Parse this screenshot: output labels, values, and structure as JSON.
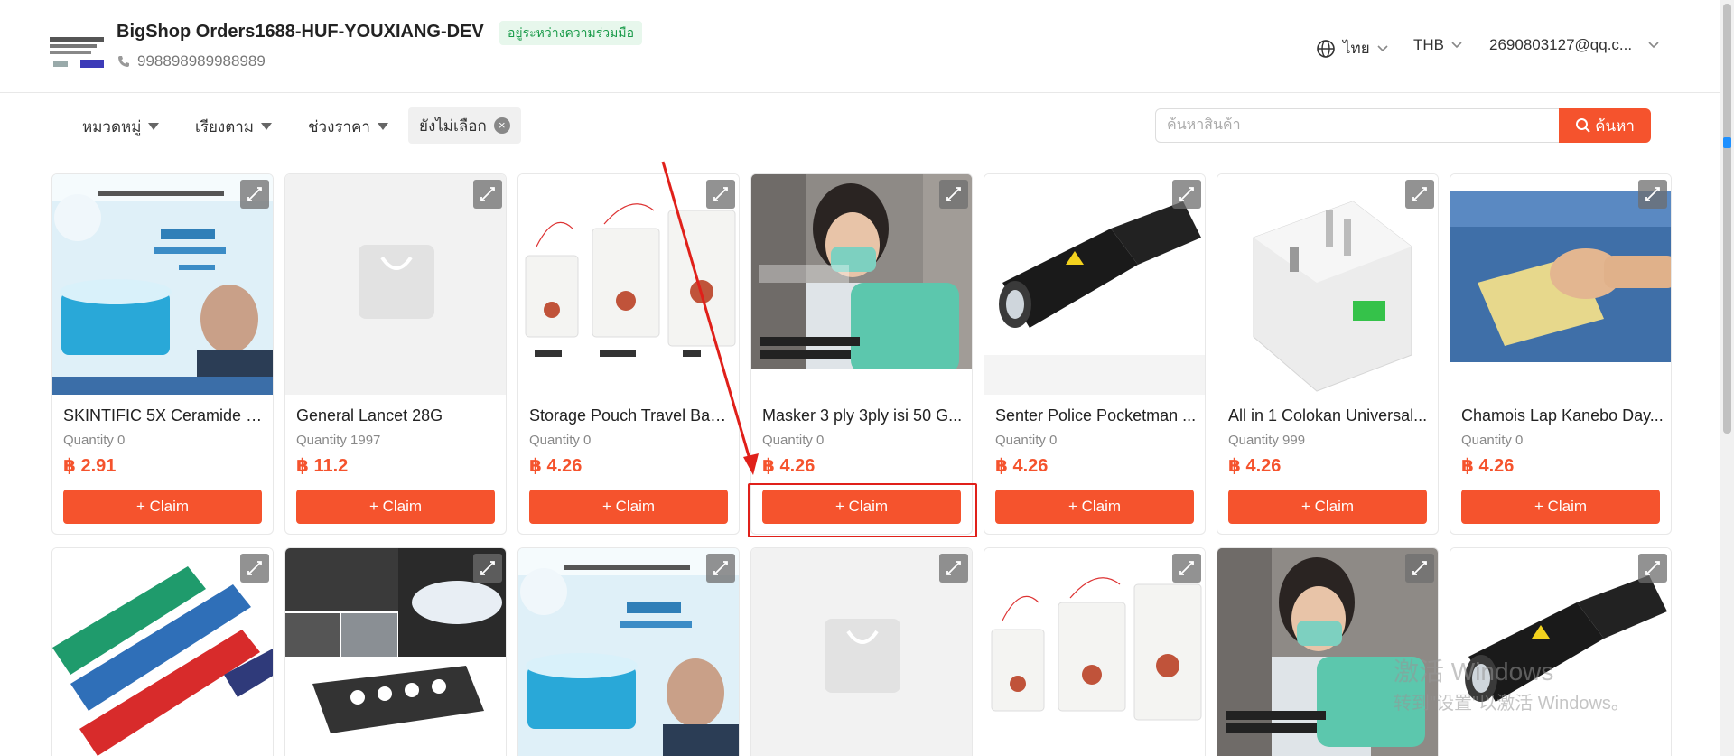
{
  "header": {
    "shop_name": "BigShop Orders1688-HUF-YOUXIANG-DEV",
    "badge": "อยู่ระหว่างความร่วมมือ",
    "phone": "998898989988989",
    "language": "ไทย",
    "currency": "THB",
    "account": "2690803127@qq.c..."
  },
  "filters": {
    "category": "หมวดหมู่",
    "sort": "เรียงตาม",
    "price_range": "ช่วงราคา",
    "selected_chip": "ยังไม่เลือก"
  },
  "search": {
    "placeholder": "ค้นหาสินค้า",
    "button": "ค้นหา"
  },
  "claim_label": "+ Claim",
  "products_row1": [
    {
      "title": "SKINTIFIC 5X Ceramide B...",
      "quantity": "Quantity 0",
      "price": "฿ 2.91",
      "image": "skincare-jar"
    },
    {
      "title": "General Lancet 28G",
      "quantity": "Quantity 1997",
      "price": "฿ 11.2",
      "image": "placeholder-bag"
    },
    {
      "title": "Storage Pouch Travel Bag...",
      "quantity": "Quantity 0",
      "price": "฿ 4.26",
      "image": "storage-pouch"
    },
    {
      "title": "Masker 3 ply 3ply isi 50 G...",
      "quantity": "Quantity 0",
      "price": "฿ 4.26",
      "image": "face-mask"
    },
    {
      "title": "Senter Police Pocketman ...",
      "quantity": "Quantity 0",
      "price": "฿ 4.26",
      "image": "flashlight"
    },
    {
      "title": "All in 1 Colokan Universal...",
      "quantity": "Quantity 999",
      "price": "฿ 4.26",
      "image": "travel-adapter"
    },
    {
      "title": "Chamois Lap Kanebo Day...",
      "quantity": "Quantity 0",
      "price": "฿ 4.26",
      "image": "chamois-cloth"
    }
  ],
  "products_row2_images": [
    "utility-knives",
    "car-led-lights",
    "skincare-jar",
    "placeholder-bag",
    "storage-pouch",
    "face-mask",
    "flashlight"
  ],
  "watermark": {
    "line1": "激活 Windows",
    "line2": "转到\"设置\"以激活 Windows。"
  },
  "colors": {
    "accent": "#f5532d",
    "badge_green": "#1a9b4a",
    "highlight_red": "#e0201a"
  }
}
